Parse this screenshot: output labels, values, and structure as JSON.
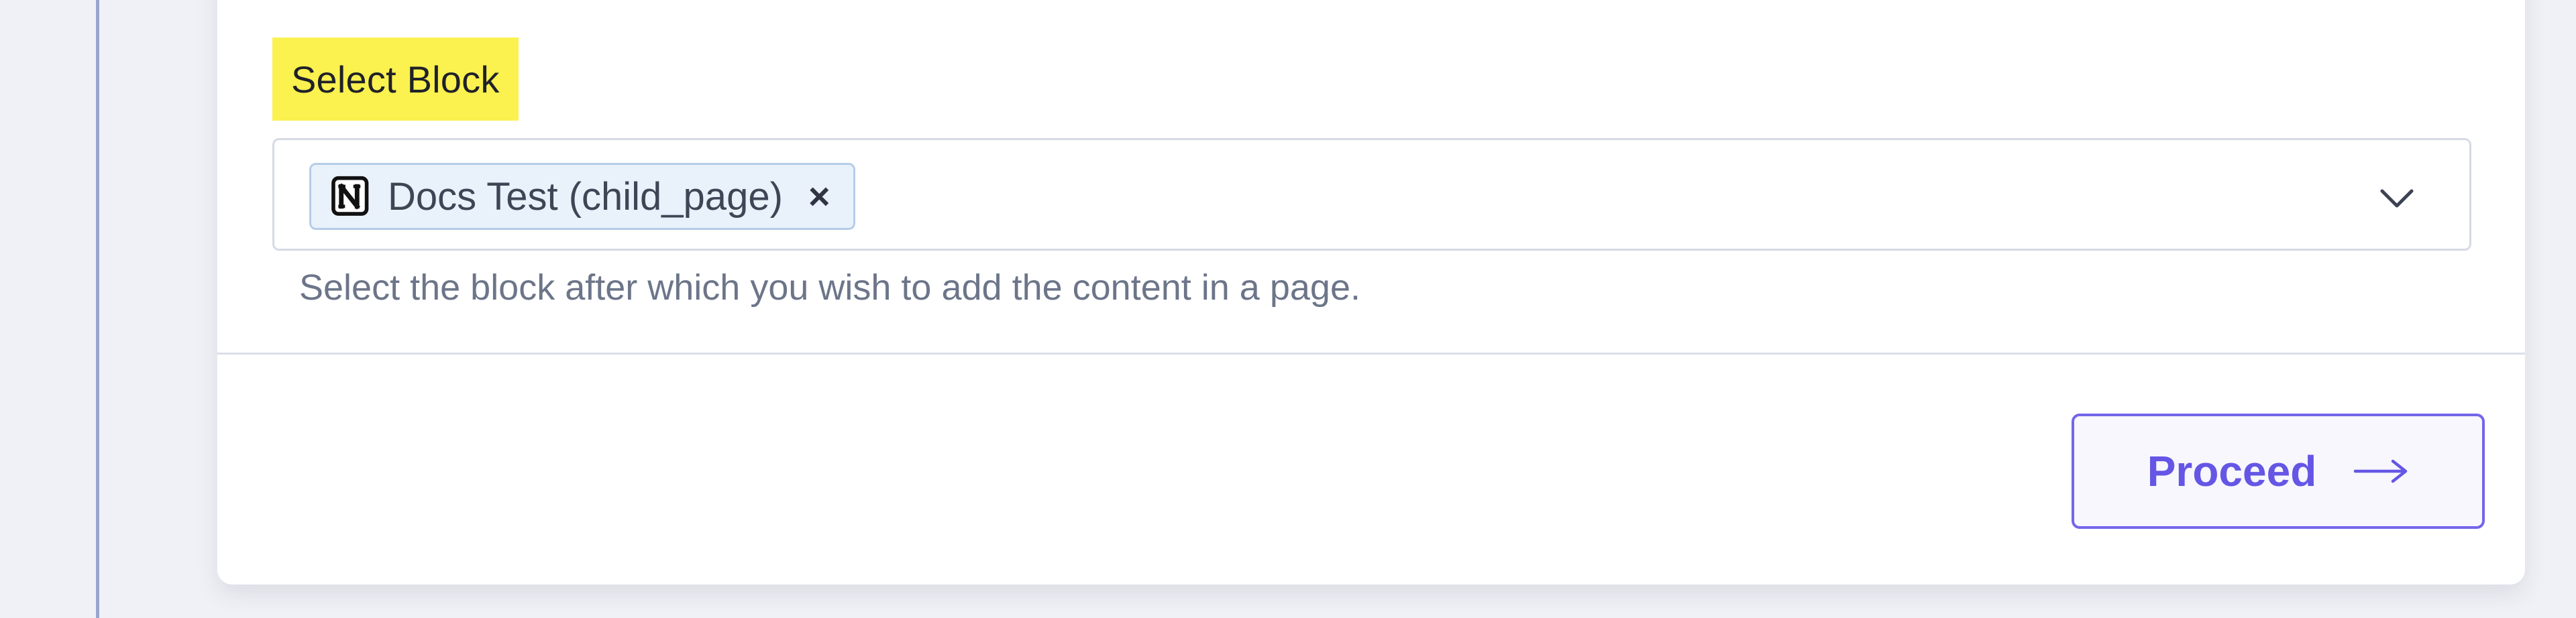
{
  "form": {
    "field_label": "Select Block",
    "selected_chip": {
      "text": "Docs Test (child_page)",
      "logo_icon": "notion-logo-icon",
      "remove_icon": "close-icon",
      "remove_glyph": "×"
    },
    "dropdown_icon": "chevron-down-icon",
    "helper_text": "Select the block after which you wish to add the content in a page."
  },
  "footer": {
    "proceed_label": "Proceed",
    "proceed_icon": "arrow-right-icon"
  },
  "colors": {
    "highlight": "#fbf14f",
    "accent": "#6556e5",
    "chip_bg": "#e9f1fb",
    "chip_border": "#b5cde8",
    "helper_text": "#6c7589",
    "page_bg": "#f0f1f6"
  }
}
